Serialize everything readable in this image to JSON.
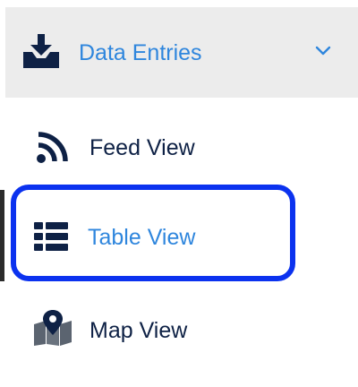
{
  "section": {
    "label": "Data Entries",
    "icon": "download-tray-icon",
    "expand_icon": "chevron-down-icon",
    "color": "#2f86dd",
    "background": "#ececec"
  },
  "nav": {
    "items": [
      {
        "label": "Feed View",
        "icon": "rss-feed-icon",
        "active": false,
        "color": "#0e2145"
      },
      {
        "label": "Table View",
        "icon": "table-list-icon",
        "active": true,
        "color": "#2f86dd"
      },
      {
        "label": "Map View",
        "icon": "map-marker-icon",
        "active": false,
        "color": "#0e2145"
      }
    ]
  },
  "colors": {
    "focus_ring": "#0b32ef",
    "icon_dark": "#0e2145",
    "active_bar": "#2b2b2b"
  }
}
